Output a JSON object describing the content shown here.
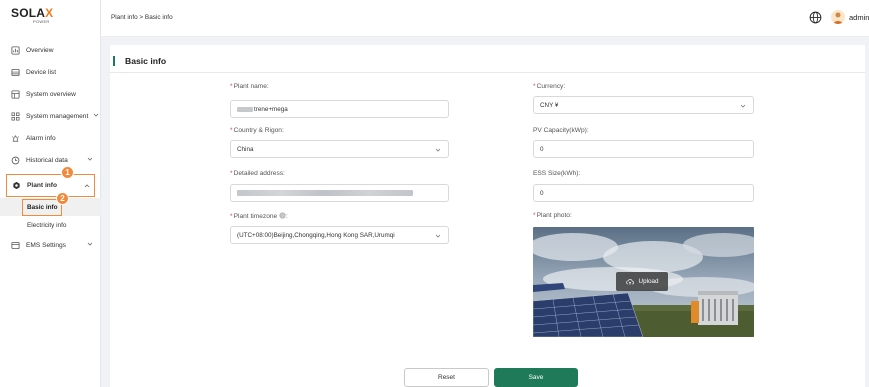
{
  "logo": {
    "brand_main": "SOLA",
    "brand_x": "X",
    "tagline": "POWER",
    "accent": "#ef7d1b"
  },
  "sidebar": {
    "items": [
      {
        "label": "Overview",
        "icon": "overview-icon"
      },
      {
        "label": "Device list",
        "icon": "device-list-icon"
      },
      {
        "label": "System overview",
        "icon": "system-overview-icon"
      },
      {
        "label": "System management",
        "icon": "system-management-icon"
      },
      {
        "label": "Alarm info",
        "icon": "alarm-icon"
      },
      {
        "label": "Historical data",
        "icon": "history-icon"
      },
      {
        "label": "Plant info",
        "icon": "plant-info-icon"
      },
      {
        "label": "EMS Settings",
        "icon": "ems-settings-icon"
      }
    ],
    "sub_items": [
      {
        "label": "Basic info"
      },
      {
        "label": "Electricity info"
      }
    ],
    "badges": [
      "1",
      "2"
    ],
    "highlight_color": "#f08a3c"
  },
  "header": {
    "breadcrumb": "Plant info  >  Basic info",
    "user": "admin"
  },
  "page": {
    "title": "Basic info",
    "accent": "#1f7a5a"
  },
  "form": {
    "plant_name": {
      "label": "Plant name:",
      "value_suffix": "trene+mega"
    },
    "country": {
      "label": "Country & Rigon:",
      "value": "China"
    },
    "address": {
      "label": "Detailed address:"
    },
    "timezone": {
      "label": "Plant timezone",
      "label_suffix": ":",
      "value": "(UTC+08:00)Beijing,Chongqing,Hong Kong SAR,Urumqi"
    },
    "currency": {
      "label": "Currency:",
      "value": "CNY ¥"
    },
    "pv_capacity": {
      "label": "PV Capacity(kWp):",
      "value": "0"
    },
    "ess_size": {
      "label": "ESS Size(kWh):",
      "value": "0"
    },
    "photo": {
      "label": "Plant photo:",
      "upload_label": "Upload"
    },
    "required_mark": "*"
  },
  "actions": {
    "reset_label": "Reset",
    "save_label": "Save"
  }
}
